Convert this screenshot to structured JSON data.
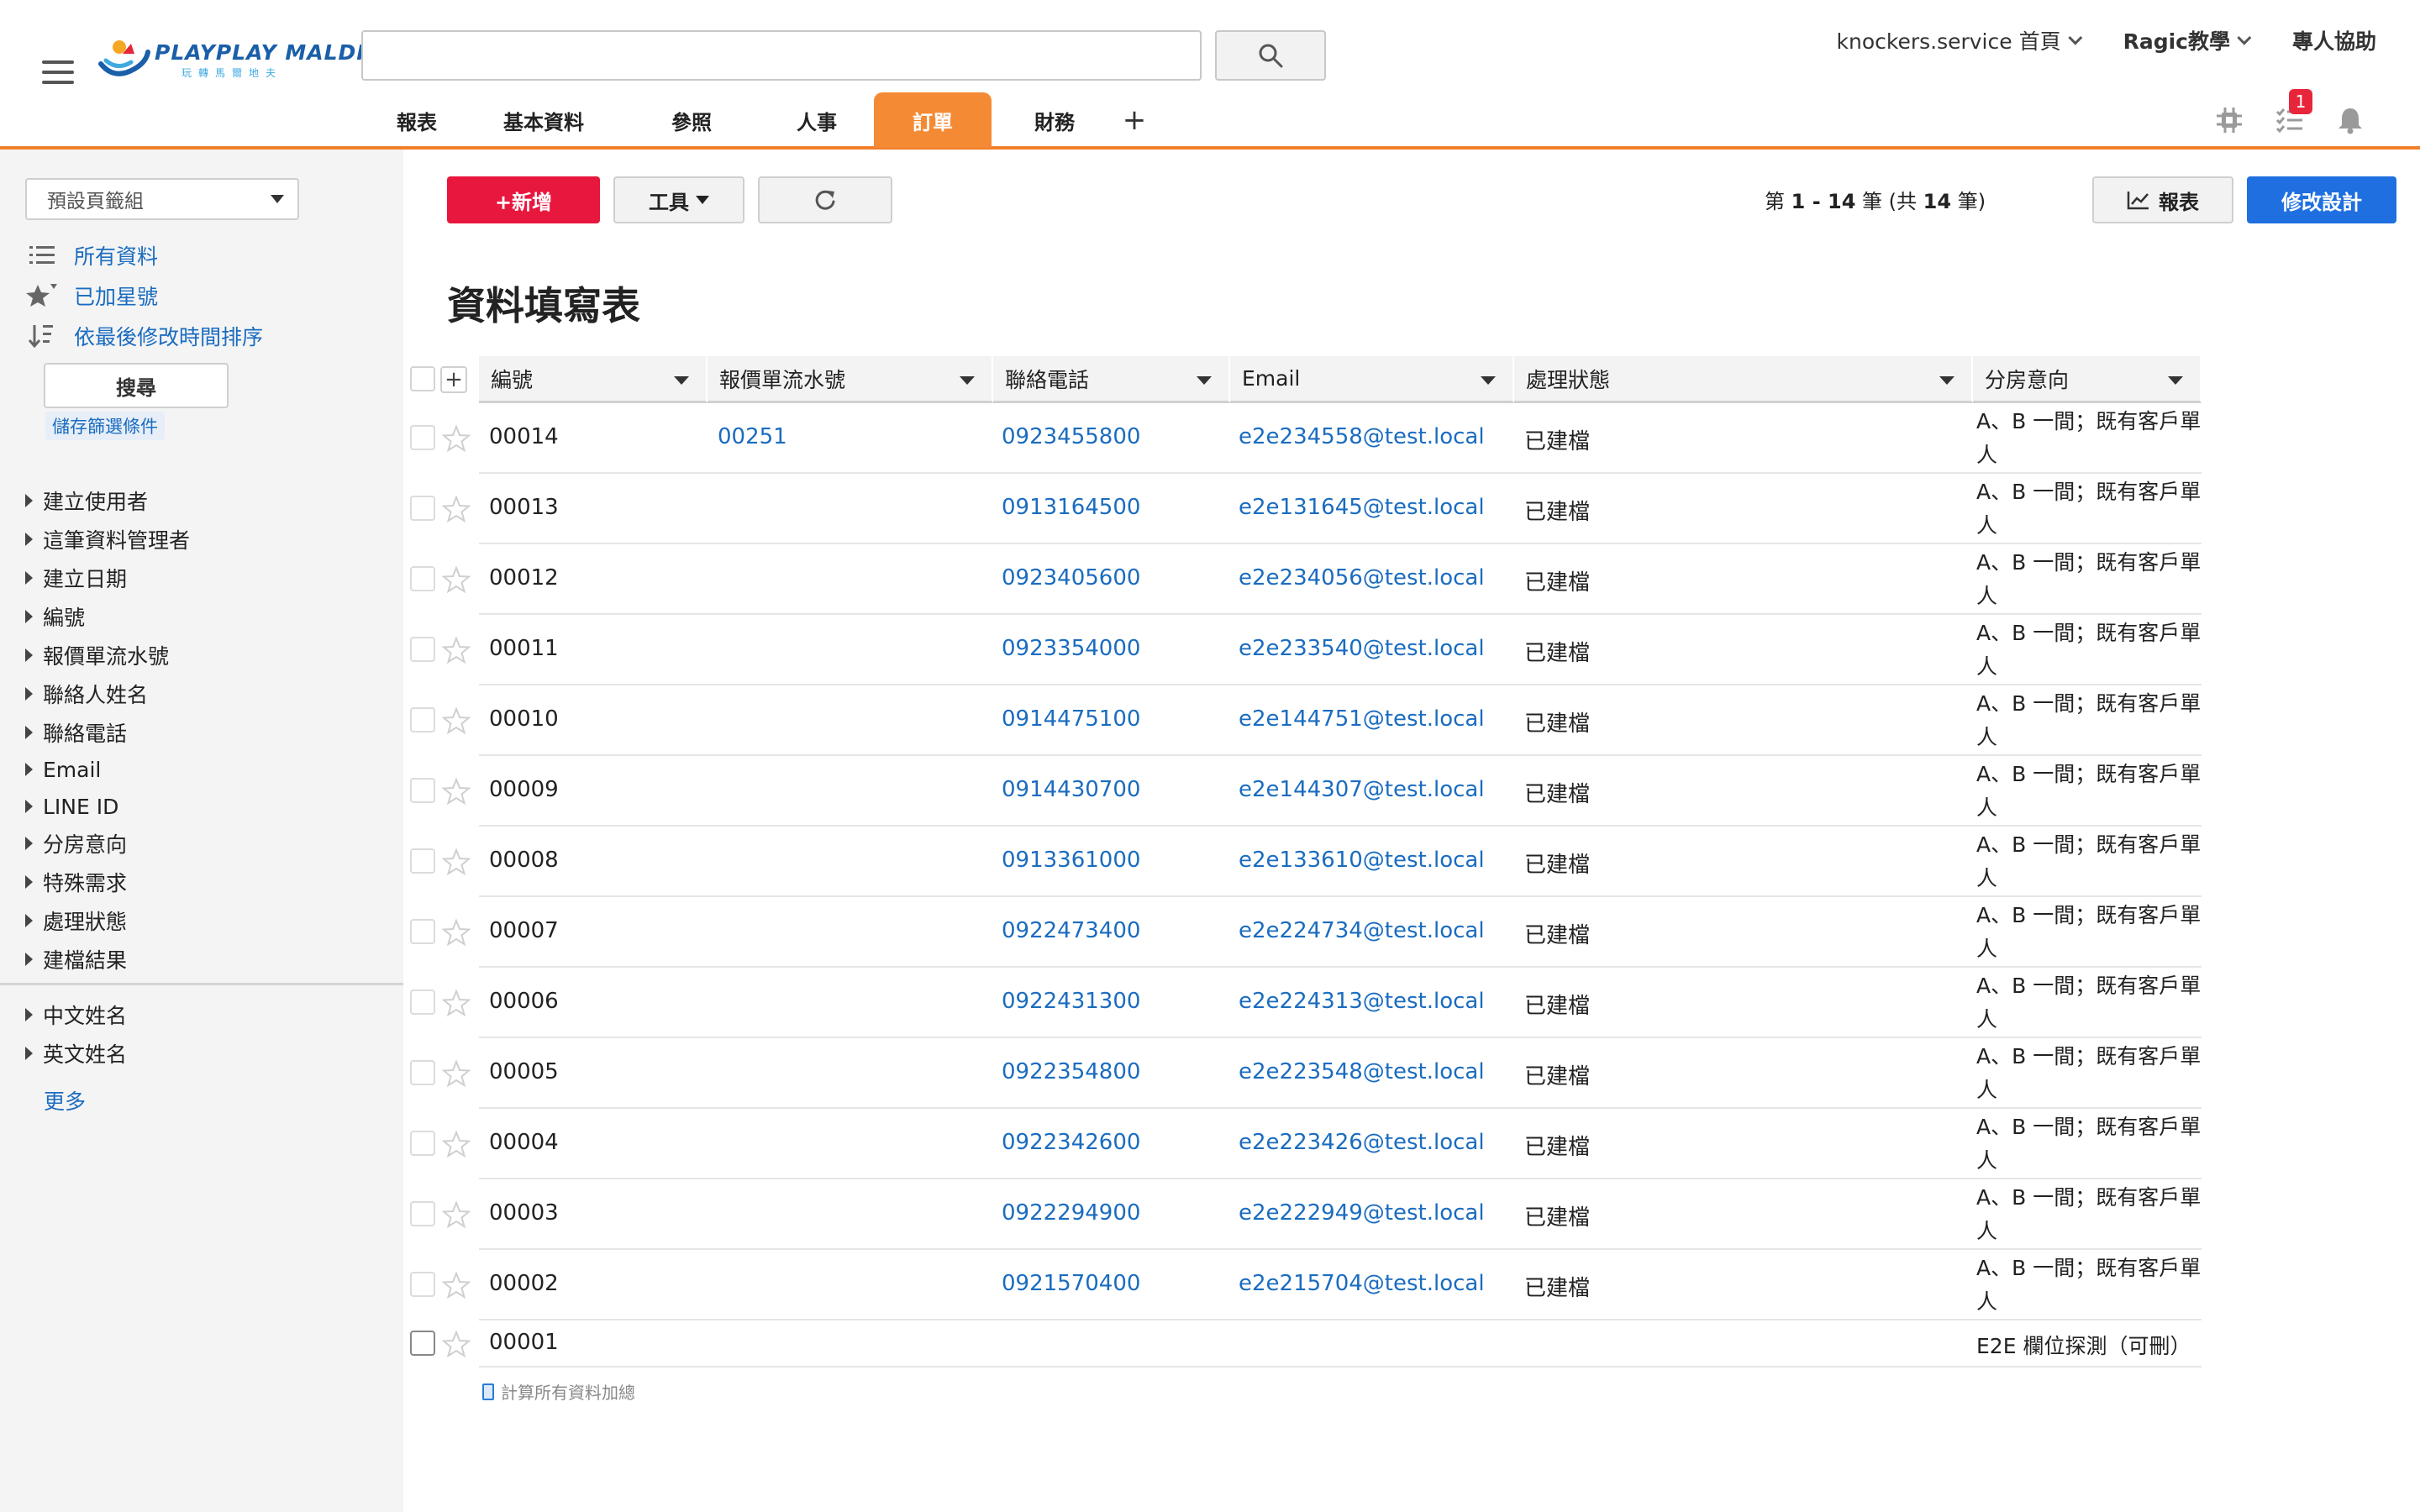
{
  "header": {
    "logo_text": "PLAYPLAY MALDIVES",
    "logo_sub": "玩轉馬爾地夫",
    "search": {
      "placeholder": "",
      "value": ""
    },
    "top_links": [
      {
        "label": "knockers.service 首頁"
      },
      {
        "label": "Ragic教學"
      },
      {
        "label": "專人協助"
      }
    ],
    "tabs": [
      {
        "label": "報表",
        "active": false
      },
      {
        "label": "基本資料",
        "active": false
      },
      {
        "label": "參照",
        "active": false
      },
      {
        "label": "人事",
        "active": false
      },
      {
        "label": "訂單",
        "active": true
      },
      {
        "label": "財務",
        "active": false
      }
    ],
    "tab_add": "+",
    "notification_count": "1",
    "accent_color": "#f58a34"
  },
  "sidebar": {
    "tab_group": "預設頁籤組",
    "links": [
      {
        "label": "所有資料",
        "icon": "list-icon"
      },
      {
        "label": "已加星號",
        "icon": "star-filter-icon"
      },
      {
        "label": "依最後修改時間排序",
        "icon": "sort-icon"
      }
    ],
    "search_label": "搜尋",
    "save_filter": "儲存篩選條件",
    "filters": [
      "建立使用者",
      "這筆資料管理者",
      "建立日期",
      "編號",
      "報價單流水號",
      "聯絡人姓名",
      "聯絡電話",
      "Email",
      "LINE ID",
      "分房意向",
      "特殊需求",
      "處理狀態",
      "建檔結果"
    ],
    "filters_extra": [
      "中文姓名",
      "英文姓名"
    ],
    "more": "更多"
  },
  "toolbar": {
    "new_label": "+新增",
    "tools_label": "工具",
    "record_prefix": "第 ",
    "record_range": "1 - 14",
    "record_mid": " 筆 (共 ",
    "record_total": "14",
    "record_suffix": " 筆)",
    "report_label": "報表",
    "design_label": "修改設計",
    "new_color": "#e8173d",
    "design_color": "#1f6fe0"
  },
  "page_title": "資料填寫表",
  "table": {
    "columns": [
      "編號",
      "報價單流水號",
      "聯絡電話",
      "Email",
      "處理狀態",
      "分房意向"
    ],
    "rows": [
      {
        "id": "00014",
        "quote": "00251",
        "phone": "0923455800",
        "email": "e2e234558@test.local",
        "status": "已建檔",
        "room": "A、B 一間；既有客戶單人"
      },
      {
        "id": "00013",
        "quote": "",
        "phone": "0913164500",
        "email": "e2e131645@test.local",
        "status": "已建檔",
        "room": "A、B 一間；既有客戶單人"
      },
      {
        "id": "00012",
        "quote": "",
        "phone": "0923405600",
        "email": "e2e234056@test.local",
        "status": "已建檔",
        "room": "A、B 一間；既有客戶單人"
      },
      {
        "id": "00011",
        "quote": "",
        "phone": "0923354000",
        "email": "e2e233540@test.local",
        "status": "已建檔",
        "room": "A、B 一間；既有客戶單人"
      },
      {
        "id": "00010",
        "quote": "",
        "phone": "0914475100",
        "email": "e2e144751@test.local",
        "status": "已建檔",
        "room": "A、B 一間；既有客戶單人"
      },
      {
        "id": "00009",
        "quote": "",
        "phone": "0914430700",
        "email": "e2e144307@test.local",
        "status": "已建檔",
        "room": "A、B 一間；既有客戶單人"
      },
      {
        "id": "00008",
        "quote": "",
        "phone": "0913361000",
        "email": "e2e133610@test.local",
        "status": "已建檔",
        "room": "A、B 一間；既有客戶單人"
      },
      {
        "id": "00007",
        "quote": "",
        "phone": "0922473400",
        "email": "e2e224734@test.local",
        "status": "已建檔",
        "room": "A、B 一間；既有客戶單人"
      },
      {
        "id": "00006",
        "quote": "",
        "phone": "0922431300",
        "email": "e2e224313@test.local",
        "status": "已建檔",
        "room": "A、B 一間；既有客戶單人"
      },
      {
        "id": "00005",
        "quote": "",
        "phone": "0922354800",
        "email": "e2e223548@test.local",
        "status": "已建檔",
        "room": "A、B 一間；既有客戶單人"
      },
      {
        "id": "00004",
        "quote": "",
        "phone": "0922342600",
        "email": "e2e223426@test.local",
        "status": "已建檔",
        "room": "A、B 一間；既有客戶單人"
      },
      {
        "id": "00003",
        "quote": "",
        "phone": "0922294900",
        "email": "e2e222949@test.local",
        "status": "已建檔",
        "room": "A、B 一間；既有客戶單人"
      },
      {
        "id": "00002",
        "quote": "",
        "phone": "0921570400",
        "email": "e2e215704@test.local",
        "status": "已建檔",
        "room": "A、B 一間；既有客戶單人"
      },
      {
        "id": "00001",
        "quote": "",
        "phone": "",
        "email": "",
        "status": "",
        "room": "E2E 欄位探測（可刪）"
      }
    ]
  },
  "calc_all": "計算所有資料加總"
}
